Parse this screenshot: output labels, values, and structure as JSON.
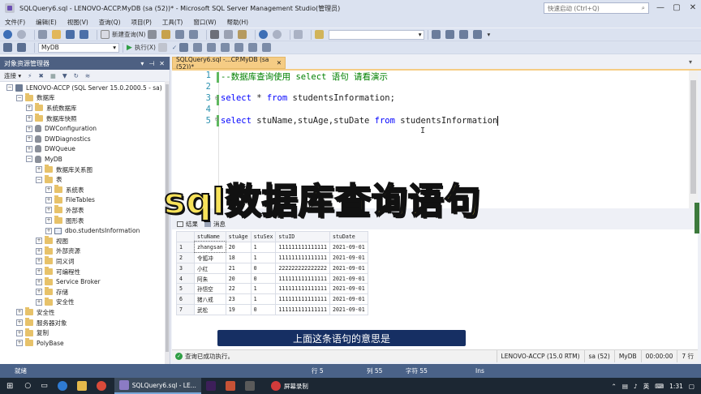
{
  "window": {
    "title": "SQLQuery6.sql - LENOVO-ACCP.MyDB (sa (52))* - Microsoft SQL Server Management Studio(管理员)",
    "quick_launch_placeholder": "快速启动 (Ctrl+Q)",
    "minimize": "—",
    "maximize": "▢",
    "close": "✕"
  },
  "menu": [
    "文件(F)",
    "编辑(E)",
    "视图(V)",
    "查询(Q)",
    "项目(P)",
    "工具(T)",
    "窗口(W)",
    "帮助(H)"
  ],
  "toolbar1": {
    "new_query_label": "新建查询(N)"
  },
  "toolbar2": {
    "database": "MyDB",
    "execute_label": "执行(X)"
  },
  "object_explorer": {
    "title": "对象资源管理器",
    "connect_label": "连接 ▾",
    "tree": [
      {
        "label": "LENOVO-ACCP (SQL Server 15.0.2000.5 - sa)",
        "indent": 0,
        "exp": "-",
        "icon": "server"
      },
      {
        "label": "数据库",
        "indent": 1,
        "exp": "-",
        "icon": "folder"
      },
      {
        "label": "系统数据库",
        "indent": 2,
        "exp": "+",
        "icon": "folder"
      },
      {
        "label": "数据库快照",
        "indent": 2,
        "exp": "+",
        "icon": "folder"
      },
      {
        "label": "DWConfiguration",
        "indent": 2,
        "exp": "+",
        "icon": "db"
      },
      {
        "label": "DWDiagnostics",
        "indent": 2,
        "exp": "+",
        "icon": "db"
      },
      {
        "label": "DWQueue",
        "indent": 2,
        "exp": "+",
        "icon": "db"
      },
      {
        "label": "MyDB",
        "indent": 2,
        "exp": "-",
        "icon": "db"
      },
      {
        "label": "数据库关系图",
        "indent": 3,
        "exp": "+",
        "icon": "folder"
      },
      {
        "label": "表",
        "indent": 3,
        "exp": "-",
        "icon": "folder"
      },
      {
        "label": "系统表",
        "indent": 4,
        "exp": "+",
        "icon": "folder"
      },
      {
        "label": "FileTables",
        "indent": 4,
        "exp": "+",
        "icon": "folder"
      },
      {
        "label": "外部表",
        "indent": 4,
        "exp": "+",
        "icon": "folder"
      },
      {
        "label": "图形表",
        "indent": 4,
        "exp": "+",
        "icon": "folder"
      },
      {
        "label": "dbo.studentsInformation",
        "indent": 4,
        "exp": "+",
        "icon": "table"
      },
      {
        "label": "视图",
        "indent": 3,
        "exp": "+",
        "icon": "folder"
      },
      {
        "label": "外部资源",
        "indent": 3,
        "exp": "+",
        "icon": "folder"
      },
      {
        "label": "同义词",
        "indent": 3,
        "exp": "+",
        "icon": "folder"
      },
      {
        "label": "可编程性",
        "indent": 3,
        "exp": "+",
        "icon": "folder"
      },
      {
        "label": "Service Broker",
        "indent": 3,
        "exp": "+",
        "icon": "folder"
      },
      {
        "label": "存储",
        "indent": 3,
        "exp": "+",
        "icon": "folder"
      },
      {
        "label": "安全性",
        "indent": 3,
        "exp": "+",
        "icon": "folder"
      },
      {
        "label": "安全性",
        "indent": 1,
        "exp": "+",
        "icon": "folder"
      },
      {
        "label": "服务器对象",
        "indent": 1,
        "exp": "+",
        "icon": "folder"
      },
      {
        "label": "复制",
        "indent": 1,
        "exp": "+",
        "icon": "folder"
      },
      {
        "label": "PolyBase",
        "indent": 1,
        "exp": "+",
        "icon": "folder"
      }
    ]
  },
  "doc_tab": {
    "label": "SQLQuery6.sql -...CP.MyDB (sa (52))*",
    "close": "✕"
  },
  "editor": {
    "lines": [
      {
        "n": "1",
        "comment": "--数据库查询使用 select 语句 请看演示"
      },
      {
        "n": "2"
      },
      {
        "n": "3",
        "kw1": "select",
        "t1": " * ",
        "kw2": "from",
        "t2": " studentsInformation;"
      },
      {
        "n": "4"
      },
      {
        "n": "5",
        "kw1": "select",
        "t1": " stuName,stuAge,stuDate ",
        "kw2": "from",
        "t2": " studentsInformation"
      }
    ]
  },
  "overlay_caption": "sql数据库查询语句",
  "results": {
    "tabs": [
      "结果",
      "消息"
    ],
    "columns": [
      "",
      "stuName",
      "stuAge",
      "stuSex",
      "stuID",
      "stuDate"
    ],
    "rows": [
      [
        "1",
        "zhangsan",
        "20",
        "1",
        "111111111111111",
        "2021-09-01"
      ],
      [
        "2",
        "令狐冲",
        "18",
        "1",
        "111111111111111",
        "2021-09-01"
      ],
      [
        "3",
        "小红",
        "21",
        "0",
        "222222222222222",
        "2021-09-01"
      ],
      [
        "4",
        "阿朱",
        "20",
        "0",
        "111111111111111",
        "2021-09-01"
      ],
      [
        "5",
        "孙悟空",
        "22",
        "1",
        "111111111111111",
        "2021-09-01"
      ],
      [
        "6",
        "猪八戒",
        "23",
        "1",
        "111111111111111",
        "2021-09-01"
      ],
      [
        "7",
        "武松",
        "19",
        "0",
        "111111111111111",
        "2021-09-01"
      ]
    ]
  },
  "subtitle": "上面这条语句的意思是",
  "query_status": {
    "message": "查询已成功执行。",
    "server": "LENOVO-ACCP (15.0 RTM)",
    "user": "sa (52)",
    "db": "MyDB",
    "time": "00:00:00",
    "rows": "7 行"
  },
  "statusbar": {
    "ready": "就绪",
    "line": "行 5",
    "col": "列 55",
    "char": "字符 55",
    "ins": "Ins"
  },
  "taskbar": {
    "ssms_label": "SQLQuery6.sql - LE...",
    "recorder_label": "屏幕录制",
    "ime": "英",
    "time": "1:31"
  }
}
